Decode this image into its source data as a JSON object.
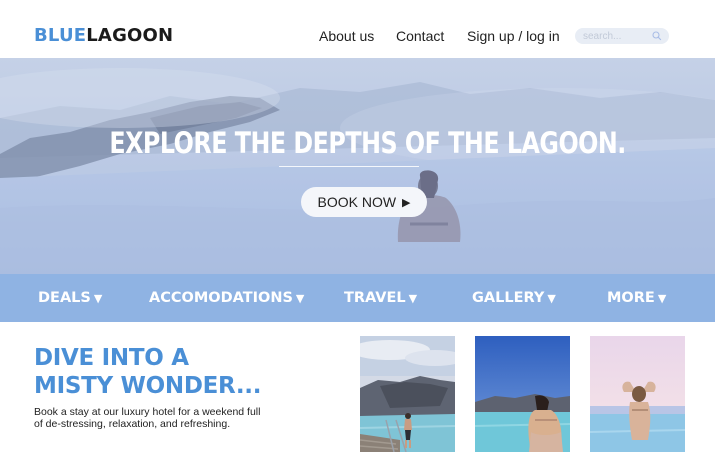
{
  "header": {
    "logo": {
      "part1": "BLUE",
      "part2": "LAGOON"
    },
    "nav": [
      {
        "label": "About us"
      },
      {
        "label": "Contact"
      },
      {
        "label": "Sign up / log in"
      }
    ],
    "search": {
      "placeholder": "search..."
    }
  },
  "hero": {
    "title": "EXPLORE THE DEPTHS OF THE LAGOON.",
    "cta_label": "BOOK NOW",
    "cta_icon": "▶"
  },
  "categories": [
    {
      "label": "DEALS",
      "caret": "▼"
    },
    {
      "label": "ACCOMODATIONS",
      "caret": "▼"
    },
    {
      "label": "TRAVEL",
      "caret": "▼"
    },
    {
      "label": "GALLERY",
      "caret": "▼"
    },
    {
      "label": "MORE",
      "caret": "▼"
    }
  ],
  "promo": {
    "headline_line1": "DIVE INTO A",
    "headline_line2": "MISTY WONDER...",
    "body_line1": "Book a stay at our luxury hotel for a weekend full",
    "body_line2": "of de-stressing, relaxation, and refreshing."
  },
  "colors": {
    "brand_blue": "#4a8fd6",
    "nav_bar": "#8fb3e3",
    "hero_tint": "#b9c8e4"
  }
}
